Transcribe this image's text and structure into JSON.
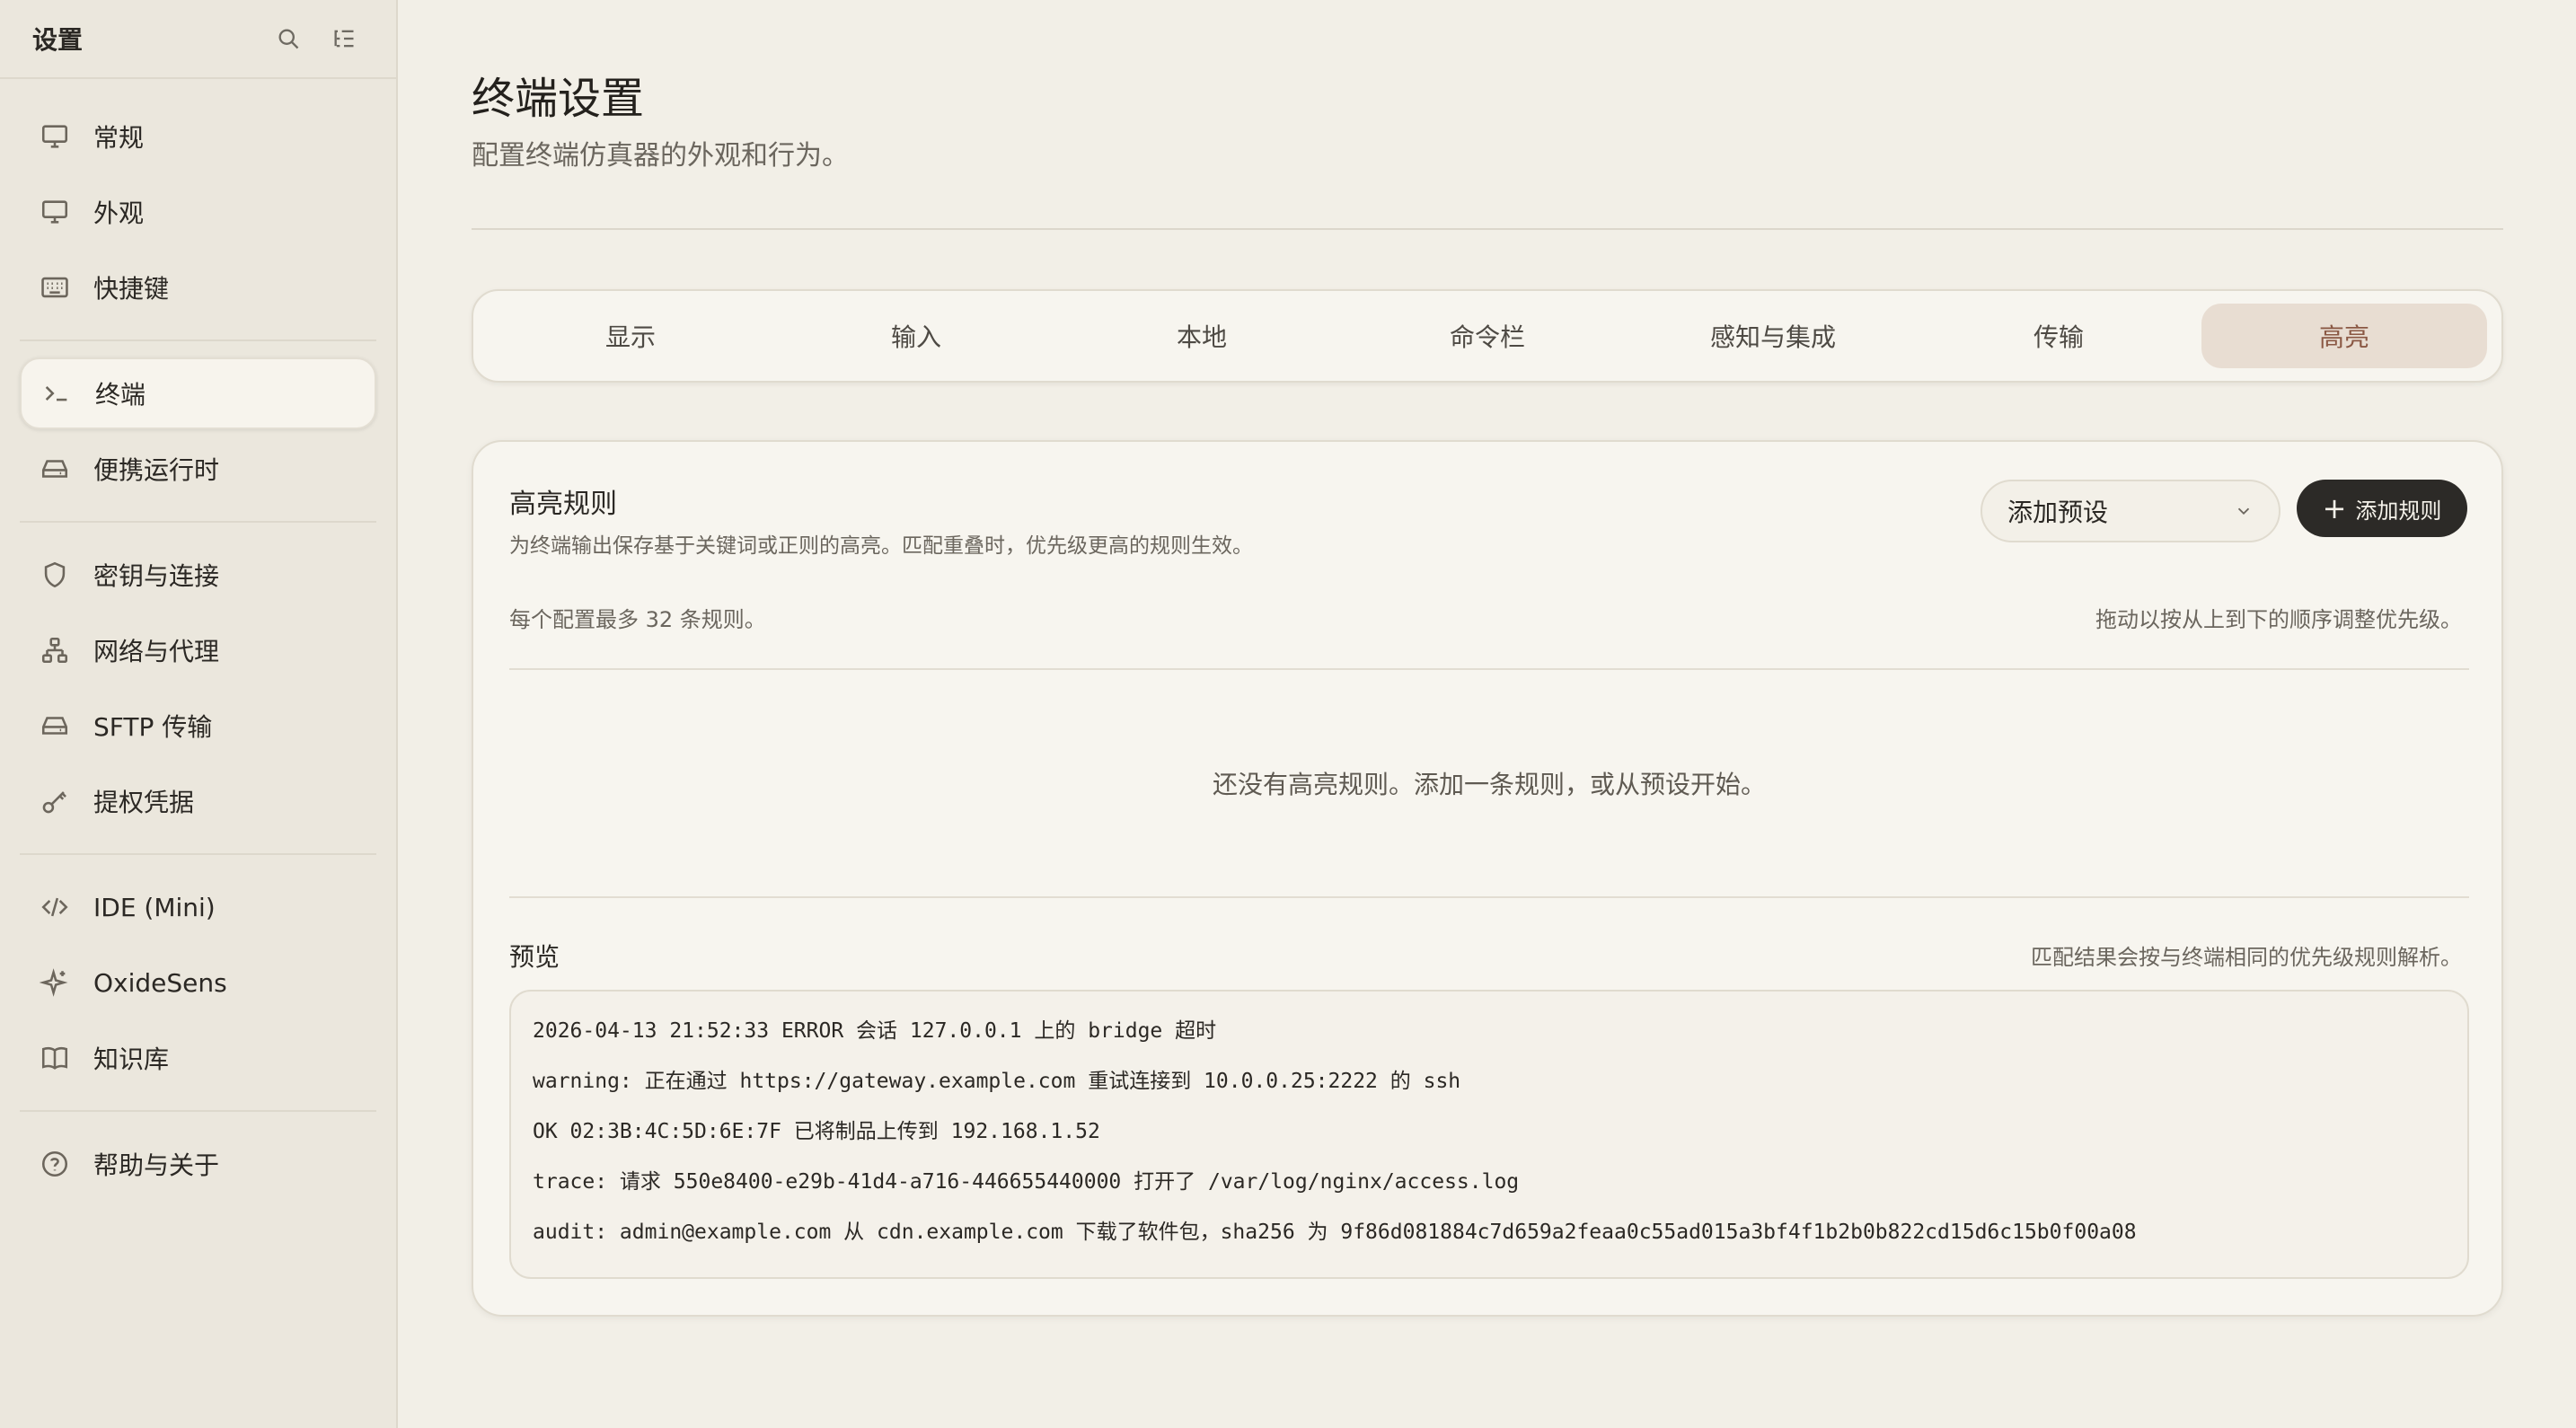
{
  "sidebar": {
    "title": "设置",
    "header_icons": [
      "search-icon",
      "list-settings-icon"
    ],
    "groups": [
      [
        {
          "label": "常规",
          "icon": "monitor-icon"
        },
        {
          "label": "外观",
          "icon": "display-icon"
        },
        {
          "label": "快捷键",
          "icon": "keyboard-icon"
        }
      ],
      [
        {
          "label": "终端",
          "icon": "terminal-icon",
          "active": true
        },
        {
          "label": "便携运行时",
          "icon": "drive-icon"
        }
      ],
      [
        {
          "label": "密钥与连接",
          "icon": "shield-icon"
        },
        {
          "label": "网络与代理",
          "icon": "network-icon"
        },
        {
          "label": "SFTP 传输",
          "icon": "storage-icon"
        },
        {
          "label": "提权凭据",
          "icon": "key-icon"
        }
      ],
      [
        {
          "label": "IDE (Mini)",
          "icon": "code-icon"
        },
        {
          "label": "OxideSens",
          "icon": "sparkle-icon"
        },
        {
          "label": "知识库",
          "icon": "book-icon"
        }
      ],
      [
        {
          "label": "帮助与关于",
          "icon": "help-icon"
        }
      ]
    ]
  },
  "page": {
    "title": "终端设置",
    "subtitle": "配置终端仿真器的外观和行为。"
  },
  "tabs": [
    {
      "label": "显示"
    },
    {
      "label": "输入"
    },
    {
      "label": "本地"
    },
    {
      "label": "命令栏"
    },
    {
      "label": "感知与集成"
    },
    {
      "label": "传输"
    },
    {
      "label": "高亮",
      "active": true
    }
  ],
  "highlight": {
    "title": "高亮规则",
    "description": "为终端输出保存基于关键词或正则的高亮。匹配重叠时，优先级更高的规则生效。",
    "preset_placeholder": "添加预设",
    "add_button": "添加规则",
    "limit_note": "每个配置最多 32 条规则。",
    "drag_note": "拖动以按从上到下的顺序调整优先级。",
    "empty_message": "还没有高亮规则。添加一条规则，或从预设开始。",
    "preview_title": "预览",
    "preview_note": "匹配结果会按与终端相同的优先级规则解析。",
    "preview_lines": [
      "2026-04-13 21:52:33 ERROR 会话 127.0.0.1 上的 bridge 超时",
      "warning: 正在通过 https://gateway.example.com 重试连接到 10.0.0.25:2222 的 ssh",
      "OK 02:3B:4C:5D:6E:7F 已将制品上传到 192.168.1.52",
      "trace: 请求 550e8400-e29b-41d4-a716-446655440000 打开了 /var/log/nginx/access.log",
      "audit: admin@example.com 从 cdn.example.com 下载了软件包，sha256 为 9f86d081884c7d659a2feaa0c55ad015a3bf4f1b2b0b822cd15d6c15b0f00a08"
    ]
  },
  "colors": {
    "background": "#f2efe7",
    "sidebar": "#ebe7dd",
    "active_tab_bg": "#e8ddd2",
    "active_tab_text": "#8a5844",
    "primary_button": "#2c2a27"
  }
}
